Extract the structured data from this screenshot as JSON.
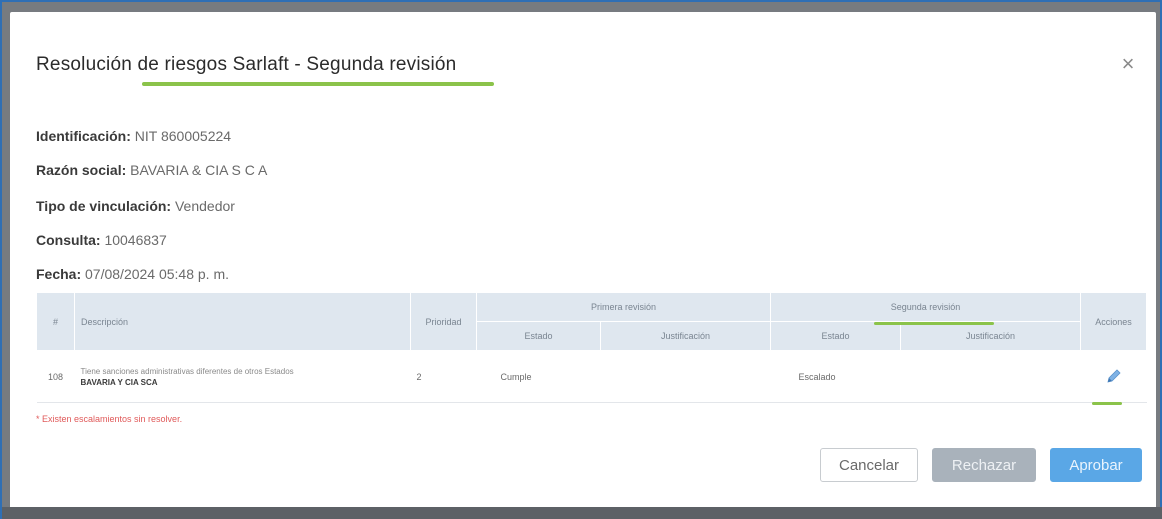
{
  "modal": {
    "title": "Resolución de riesgos Sarlaft - Segunda revisión",
    "close_glyph": "×"
  },
  "info": {
    "identificacion_label": "Identificación:",
    "identificacion_value": "NIT 860005224",
    "razon_label": "Razón social:",
    "razon_value": "BAVARIA & CIA S C A",
    "tipo_label": "Tipo de vinculación:",
    "tipo_value": "Vendedor",
    "consulta_label": "Consulta:",
    "consulta_value": "10046837",
    "fecha_label": "Fecha:",
    "fecha_value": "07/08/2024 05:48 p. m."
  },
  "table": {
    "headers": {
      "num": "#",
      "descripcion": "Descripción",
      "prioridad": "Prioridad",
      "primera": "Primera revisión",
      "segunda": "Segunda revisión",
      "acciones": "Acciones",
      "estado": "Estado",
      "justificacion": "Justificación"
    },
    "rows": [
      {
        "num": "108",
        "desc_line1": "Tiene sanciones administrativas diferentes de otros Estados",
        "desc_line2": "BAVARIA Y CIA SCA",
        "prioridad": "2",
        "primera_estado": "Cumple",
        "primera_justificacion": "",
        "segunda_estado": "Escalado",
        "segunda_justificacion": "",
        "action_icon": "pencil-icon"
      }
    ]
  },
  "note": "* Existen escalamientos sin resolver.",
  "buttons": {
    "cancel": "Cancelar",
    "reject": "Rechazar",
    "approve": "Aprobar"
  },
  "colors": {
    "highlight": "#8bc34a",
    "primary": "#5aa7e6",
    "disabled": "#a9b2bb",
    "header_bg": "#dfe7ef",
    "warning_text": "#e05a5a"
  }
}
